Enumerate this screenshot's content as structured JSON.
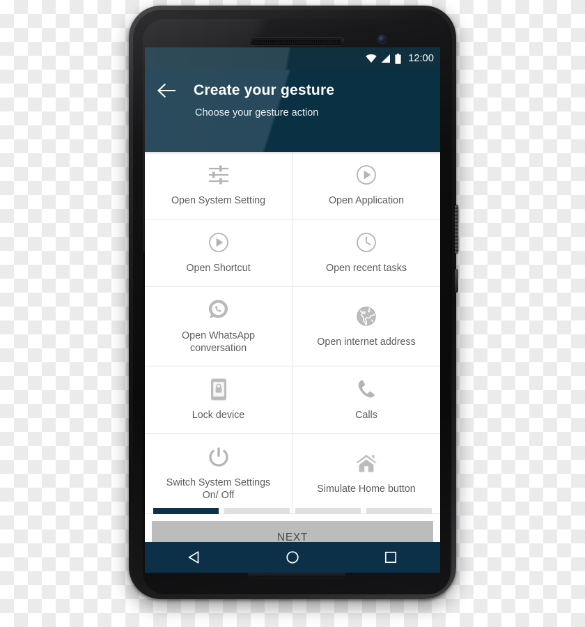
{
  "device": {
    "type": "android-smartphone",
    "frame_color": "#16161a"
  },
  "status_bar": {
    "time": "12:00",
    "icons": [
      "wifi-icon",
      "signal-icon",
      "battery-icon"
    ],
    "background": "#11303f"
  },
  "app_bar": {
    "back_label": "back-arrow",
    "title": "Create your gesture",
    "subtitle": "Choose your gesture action",
    "background": "#0a3044"
  },
  "grid": {
    "items": [
      {
        "label": "Open System Setting",
        "icon": "sliders-settings-icon"
      },
      {
        "label": "Open Application",
        "icon": "play-circle-icon"
      },
      {
        "label": "Open Shortcut",
        "icon": "play-circle-icon"
      },
      {
        "label": "Open recent tasks",
        "icon": "clock-icon"
      },
      {
        "label": "Open WhatsApp conversation",
        "icon": "whatsapp-icon"
      },
      {
        "label": "Open internet address",
        "icon": "globe-icon"
      },
      {
        "label": "Lock device",
        "icon": "phone-lock-icon"
      },
      {
        "label": "Calls",
        "icon": "phone-handset-icon"
      },
      {
        "label": "Switch System Settings On/ Off",
        "icon": "power-icon"
      },
      {
        "label": "Simulate Home button",
        "icon": "home-icon"
      }
    ]
  },
  "pagination": {
    "total": 4,
    "current": 1,
    "active_color": "#0d3149",
    "inactive_color": "#e0e0e0"
  },
  "next_button": {
    "label": "NEXT",
    "background": "#bcbcbc",
    "text_color": "#4a4a4a"
  },
  "nav_bar": {
    "background": "#0d3049",
    "buttons": [
      {
        "name": "back",
        "icon": "triangle-back-icon"
      },
      {
        "name": "home",
        "icon": "circle-home-icon"
      },
      {
        "name": "recents",
        "icon": "square-recents-icon"
      }
    ]
  }
}
